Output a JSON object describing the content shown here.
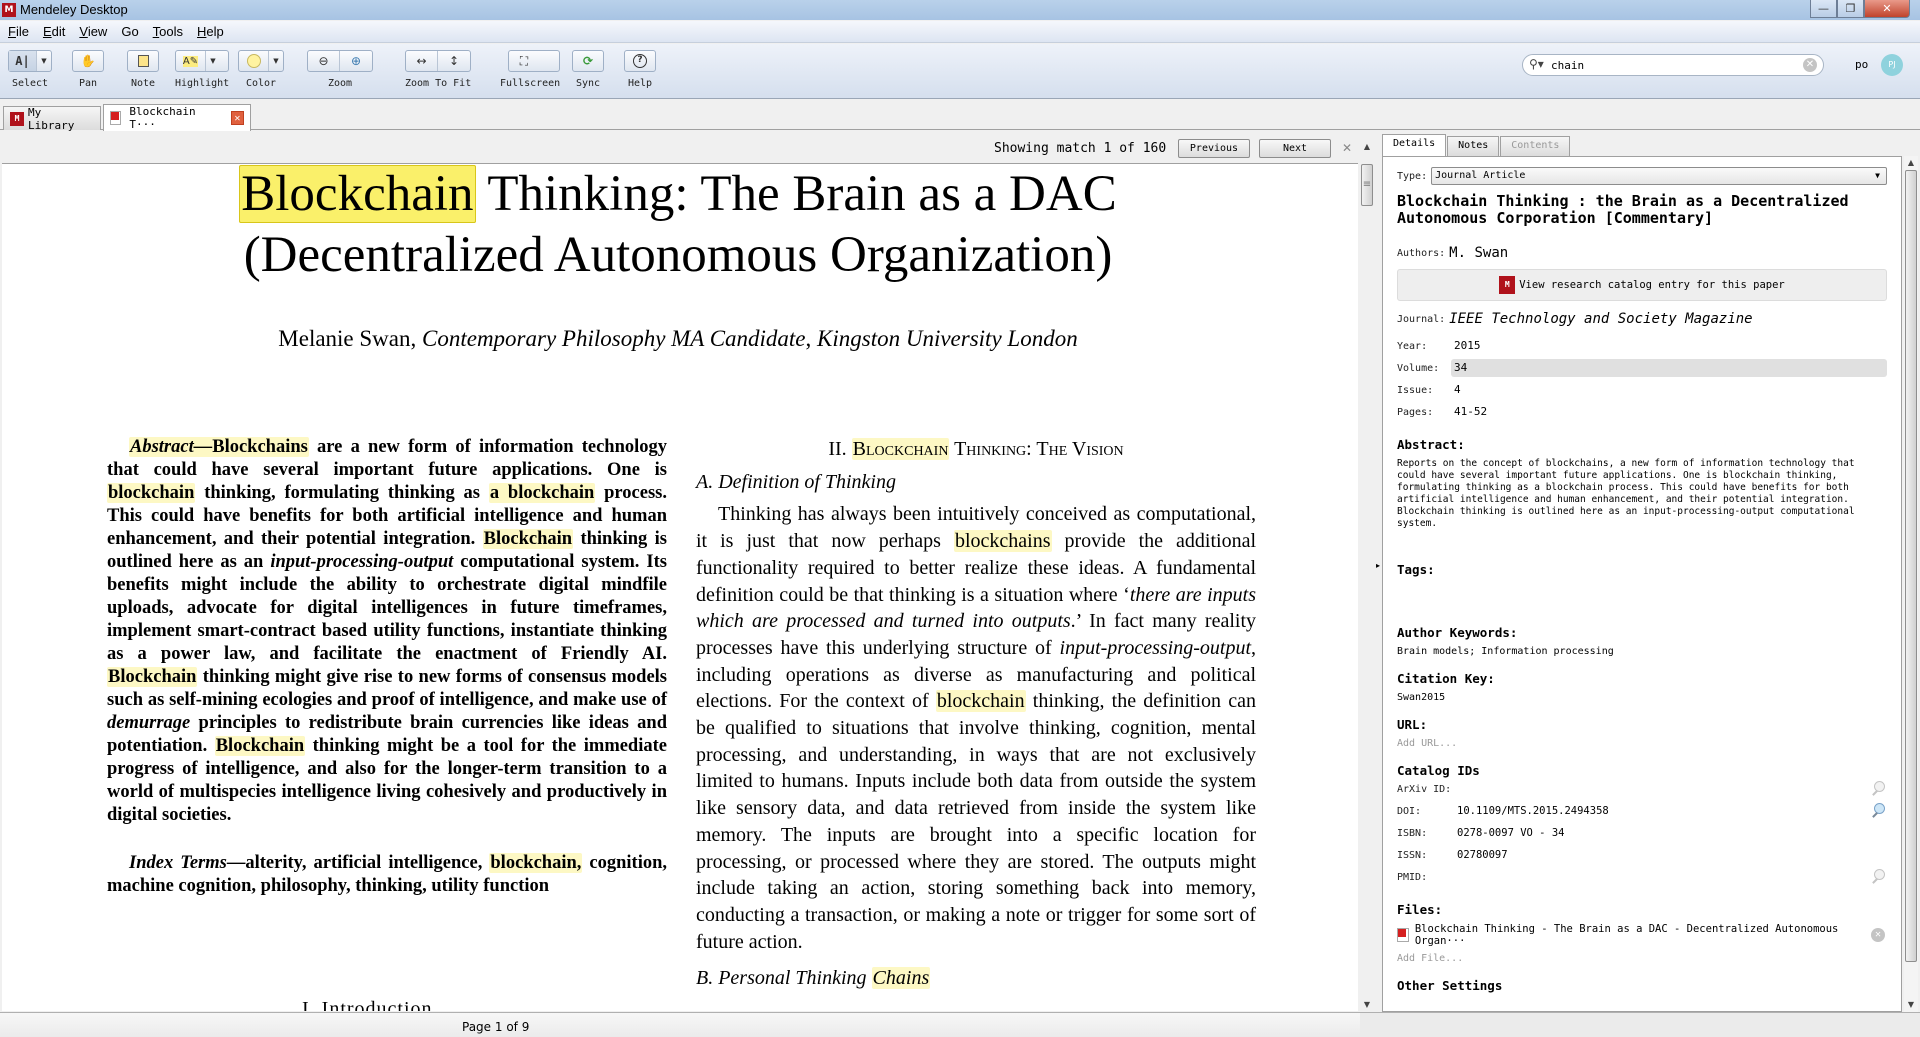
{
  "window": {
    "title": "Mendeley Desktop",
    "logo_glyph": "M",
    "controls": {
      "minimize": "—",
      "maximize": "❐",
      "close": "✕"
    }
  },
  "menu": [
    {
      "label": "File",
      "accel": "F",
      "rest": "ile"
    },
    {
      "label": "Edit",
      "accel": "E",
      "rest": "dit"
    },
    {
      "label": "View",
      "accel": "V",
      "rest": "iew"
    },
    {
      "label": "Go",
      "accel": "",
      "rest": "Go"
    },
    {
      "label": "Tools",
      "accel": "T",
      "rest": "ools"
    },
    {
      "label": "Help",
      "accel": "H",
      "rest": "elp"
    }
  ],
  "toolbar": {
    "select": {
      "label": "Select",
      "icon": "A|"
    },
    "pan": {
      "label": "Pan",
      "icon": "✋"
    },
    "note": {
      "label": "Note",
      "icon": "▢"
    },
    "highlight": {
      "label": "Highlight",
      "icon": "A✎"
    },
    "color": {
      "label": "Color",
      "icon": "●",
      "value": "#fff3a0"
    },
    "zoom": {
      "label": "Zoom",
      "out_icon": "⊖",
      "in_icon": "⊕"
    },
    "zoom_to_fit": {
      "label": "Zoom To Fit",
      "width_icon": "↔",
      "height_icon": "↕"
    },
    "fullscreen": {
      "label": "Fullscreen",
      "icon": "⛶"
    },
    "sync": {
      "label": "Sync",
      "icon": "⟳"
    },
    "help": {
      "label": "Help",
      "icon": "?"
    },
    "dropdown_glyph": "▼"
  },
  "search": {
    "icon": "⚲▾",
    "value": "chain",
    "clear_glyph": "✕"
  },
  "user": {
    "name": "po",
    "initials": "PJ"
  },
  "tabs": [
    {
      "label": "My Library"
    },
    {
      "label": "Blockchain T···",
      "close_glyph": "✕"
    }
  ],
  "find": {
    "status": "Showing match 1 of 160",
    "previous": "Previous",
    "next": "Next",
    "close_glyph": "✕",
    "query": "chain",
    "current": 1,
    "total": 160
  },
  "document": {
    "title_hl": "Blockchain",
    "title_rest1": " Thinking: The Brain as a DAC",
    "title_line2": "(Decentralized Autonomous Organization)",
    "author_name": "Melanie Swan, ",
    "author_affil": "Contemporary Philosophy MA Candidate",
    "author_sep": ", ",
    "author_inst": "Kingston University London",
    "abstract": {
      "label": "Abstract—",
      "p1": "Blockchains",
      "p2": " are a new form of information technology that could have several important future applications. One is ",
      "p3": "blockchain",
      "p4": " thinking, formulating thinking as ",
      "p5": "a blockchain",
      "p6": " process. This could have benefits for both artificial intelligence and human enhancement, and their potential integration. ",
      "p7": "Blockchain",
      "p8": " thinking is outlined here as an ",
      "p9": "input-processing-output",
      "p10": " computational system. Its benefits might include the ability to orchestrate digital mindfile uploads, advocate for digital intelligences in future timeframes, implement smart-contract based utility functions, instantiate thinking as a power law, and facilitate the enactment of Friendly AI. ",
      "p11": "Blockchain",
      "p12": " thinking might give rise to new forms of consensus models such as self-mining ecologies and proof of intelligence, and make use of ",
      "p13": "demurrage",
      "p14": " principles to redistribute brain currencies like ideas and potentiation. ",
      "p15": "Blockchain",
      "p16": " thinking might be a tool for the immediate progress of intelligence, and also for the longer-term transition to a world of multispecies intelligence living cohesively and productively in digital societies."
    },
    "index_terms": {
      "label": "Index Terms",
      "dash": "—alterity, artificial intelligence, ",
      "hl": "blockchain,",
      "rest": " cognition, machine cognition, philosophy, thinking, utility function"
    },
    "intro_heading": "I.   Introduction",
    "section2": {
      "num": "II.  ",
      "hl": "Blockchain",
      "rest": " Thinking: The Vision"
    },
    "subsection_a": "A.   Definition of Thinking",
    "body": {
      "b1": "Thinking has always been intuitively conceived as computational, it is just that now perhaps ",
      "b2": "blockchains",
      "b3": " provide the additional functionality required to better realize these ideas. A fundamental definition could be that thinking is a situation where ‘",
      "b4": "there are inputs which are processed and turned into outputs",
      "b5": ".’ In fact many reality processes have this underlying structure of ",
      "b6": "input-processing-output",
      "b7": ", including operations as diverse as manufacturing and political elections. For the context of ",
      "b8": "blockchain",
      "b9": " thinking, the definition can be qualified to situations that involve thinking, cognition, mental processing, and understanding, in ways that are not exclusively limited to humans. Inputs include both data from outside the system like sensory data, and data retrieved from inside the system like memory. The inputs are brought into a specific location for processing, or processed where they are stored. The outputs might include taking an action, storing something back into memory, conducting a transaction, or making a note or trigger for some sort of future action."
    },
    "subsection_b": {
      "text": "B.   Personal Thinking ",
      "hl": "Chains"
    },
    "page_indicator": "Page 1 of 9",
    "highlight_color": "#fdf8c4",
    "current_match_color": "#faf06a"
  },
  "details_panel": {
    "tabs": [
      {
        "label": "Details"
      },
      {
        "label": "Notes"
      },
      {
        "label": "Contents"
      }
    ],
    "type_label": "Type:",
    "type_value": "Journal Article",
    "title": "Blockchain Thinking : the Brain as a Decentralized Autonomous Corporation [Commentary]",
    "authors_label": "Authors:",
    "authors_value": "M. Swan",
    "catalog_button": "View research catalog entry for this paper",
    "journal_label": "Journal:",
    "journal_value": "IEEE Technology and Society Magazine",
    "fields": [
      {
        "label": "Year:",
        "value": "2015"
      },
      {
        "label": "Volume:",
        "value": "34"
      },
      {
        "label": "Issue:",
        "value": "4"
      },
      {
        "label": "Pages:",
        "value": "41-52"
      }
    ],
    "abstract_label": "Abstract:",
    "abstract_text": "Reports on the concept of blockchains, a new form of information technology that could have several important future applications. One is blockchain thinking, formulating thinking as a blockchain process. This could have benefits for both artificial intelligence and human enhancement, and their potential integration. Blockchain thinking is outlined here as an input-processing-output computational system.",
    "tags_label": "Tags:",
    "keywords_label": "Author Keywords:",
    "keywords_value": "Brain models; Information processing",
    "citation_key_label": "Citation Key:",
    "citation_key_value": "Swan2015",
    "url_label": "URL:",
    "url_placeholder": "Add URL...",
    "catalog_ids_label": "Catalog IDs",
    "catalog_ids": [
      {
        "label": "ArXiv ID:",
        "value": ""
      },
      {
        "label": "DOI:",
        "value": "10.1109/MTS.2015.2494358"
      },
      {
        "label": "ISBN:",
        "value": "0278-0097 VO - 34"
      },
      {
        "label": "ISSN:",
        "value": "02780097"
      },
      {
        "label": "PMID:",
        "value": ""
      }
    ],
    "files_label": "Files:",
    "file_name": "Blockchain Thinking - The Brain as a DAC - Decentralized Autonomous Organ···",
    "file_remove_glyph": "✕",
    "add_file": "Add File...",
    "other_settings_label": "Other Settings"
  },
  "scroll": {
    "up": "▲",
    "down": "▼",
    "grip": "≡",
    "split": "▸"
  }
}
